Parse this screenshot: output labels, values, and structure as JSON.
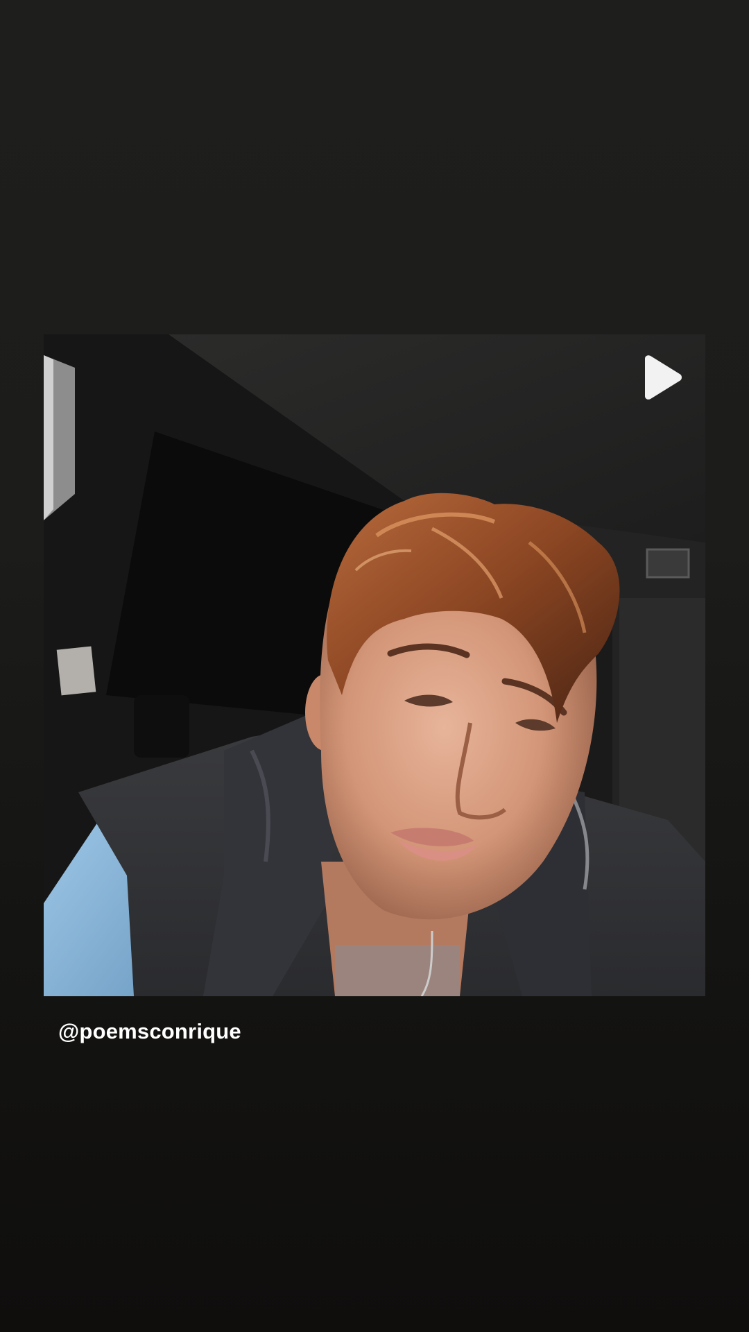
{
  "post": {
    "username": "@poemsconrique",
    "media_type": "video",
    "play_icon": "play-icon"
  },
  "colors": {
    "background_top": "#1e1e1c",
    "background_bottom": "#0f0e0d",
    "username_text": "#ffffff",
    "play_icon": "#f2f2f2"
  }
}
